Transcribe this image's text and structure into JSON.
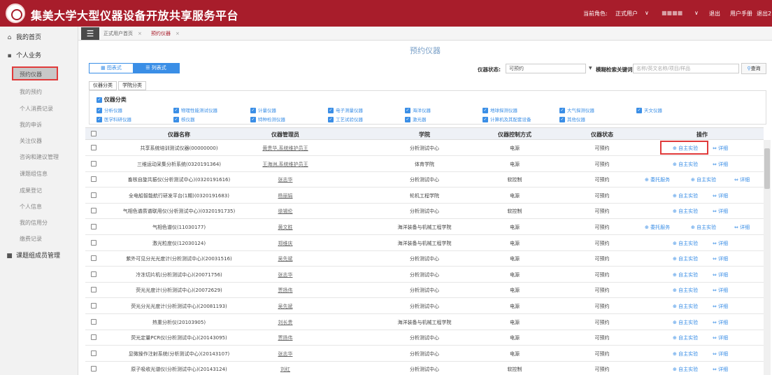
{
  "app": {
    "title": "集美大学大型仪器设备开放共享服务平台"
  },
  "topbar": {
    "role_label": "当前角色:",
    "role_value": "正式用户",
    "user_name": "■■■■",
    "logout": "退出",
    "manual": "用户手册",
    "last": "退出2"
  },
  "sidebar": {
    "items": [
      {
        "label": "我的首页",
        "icon": "home-icon",
        "type": "main"
      },
      {
        "label": "个人业务",
        "icon": "briefcase-icon",
        "type": "main"
      },
      {
        "label": "预约仪器",
        "type": "sub",
        "active": true
      },
      {
        "label": "我的预约",
        "type": "sub"
      },
      {
        "label": "个人消费记录",
        "type": "sub"
      },
      {
        "label": "我的申诉",
        "type": "sub"
      },
      {
        "label": "关注仪器",
        "type": "sub"
      },
      {
        "label": "咨询和建议管理",
        "type": "sub"
      },
      {
        "label": "课题组信息",
        "type": "sub"
      },
      {
        "label": "成果登记",
        "type": "sub"
      },
      {
        "label": "个人信息",
        "type": "sub"
      },
      {
        "label": "我的信用分",
        "type": "sub"
      },
      {
        "label": "缴费记录",
        "type": "sub"
      },
      {
        "label": "课题组成员管理",
        "icon": "book-icon",
        "type": "main"
      }
    ]
  },
  "tabs": [
    {
      "label": "正式用户首页",
      "close": "×"
    },
    {
      "label": "预约仪器",
      "close": "×"
    }
  ],
  "page": {
    "heading": "预约仪器"
  },
  "view": {
    "chart": "图表式",
    "list": "列表式"
  },
  "filter": {
    "status_label": "仪器状态:",
    "status_value": "可预约",
    "keyword_label": "模糊检索关键词:",
    "keyword_placeholder": "名称/英文名称/项目/样品",
    "search_btn": "查询"
  },
  "category_tabs": [
    "仪器分类",
    "学院分类"
  ],
  "categories": {
    "title": "仪器分类",
    "items": [
      "分析仪器",
      "物理性能测试仪器",
      "计量仪器",
      "电子测量仪器",
      "海洋仪器",
      "地球探测仪器",
      "大气探测仪器",
      "天文仪器",
      "医学科研仪器",
      "核仪器",
      "特种检测仪器",
      "工艺试验仪器",
      "激光器",
      "计算机及其配套设备",
      "其他仪器"
    ]
  },
  "table": {
    "headers": {
      "name": "仪器名称",
      "manager": "仪器管理员",
      "college": "学院",
      "control": "仪器控制方式",
      "status": "仪器状态",
      "ops": "操作"
    },
    "actions": {
      "entrust": "委托服务",
      "self": "自主实验",
      "detail": "详细"
    },
    "rows": [
      {
        "name": "共享系统培训测试仪器(00000000)",
        "manager": "黄贵华,系统维护员王",
        "college": "分析测试中心",
        "control": "电源",
        "status": "可预约",
        "entrust": false
      },
      {
        "name": "三维运动采集分析系统(0320191364)",
        "manager": "王海洲,系统维护员王",
        "college": "体育学院",
        "control": "电源",
        "status": "可预约",
        "entrust": false
      },
      {
        "name": "畜核自旋共振仪(分析测试中心)(0320191616)",
        "manager": "张志华",
        "college": "分析测试中心",
        "control": "软控制",
        "status": "可预约",
        "entrust": true
      },
      {
        "name": "全电船智能航行研发平台(1期)(0320191683)",
        "manager": "杨丽娟",
        "college": "轮机工程学院",
        "control": "电源",
        "status": "可预约",
        "entrust": false
      },
      {
        "name": "气相色谱质谱联用仪(分析测试中心)(0320191735)",
        "manager": "徐锡伦",
        "college": "分析测试中心",
        "control": "软控制",
        "status": "可预约",
        "entrust": false
      },
      {
        "name": "气相色谱仪(11030177)",
        "manager": "黄文胜",
        "college": "海洋装备与机械工程学院",
        "control": "电源",
        "status": "可预约",
        "entrust": true
      },
      {
        "name": "激光粒度仪(12030124)",
        "manager": "郑维庆",
        "college": "海洋装备与机械工程学院",
        "control": "电源",
        "status": "可预约",
        "entrust": false
      },
      {
        "name": "紫外可见分光光度计(分析测试中心)(20031516)",
        "manager": "吴先斌",
        "college": "分析测试中心",
        "control": "电源",
        "status": "可预约",
        "entrust": false
      },
      {
        "name": "冷冻切片机(分析测试中心)(20071756)",
        "manager": "张志华",
        "college": "分析测试中心",
        "control": "电源",
        "status": "可预约",
        "entrust": false
      },
      {
        "name": "荧光光度计(分析测试中心)(20072629)",
        "manager": "贾扬伟",
        "college": "分析测试中心",
        "control": "电源",
        "status": "可预约",
        "entrust": false
      },
      {
        "name": "荧光分光光度计(分析测试中心)(20081193)",
        "manager": "吴先斌",
        "college": "分析测试中心",
        "control": "电源",
        "status": "可预约",
        "entrust": false
      },
      {
        "name": "热重分析仪(20103905)",
        "manager": "刘长贵",
        "college": "海洋装备与机械工程学院",
        "control": "电源",
        "status": "可预约",
        "entrust": false
      },
      {
        "name": "荧光定量PCR仪(分析测试中心)(20143095)",
        "manager": "贾扬伟",
        "college": "分析测试中心",
        "control": "电源",
        "status": "可预约",
        "entrust": false
      },
      {
        "name": "显微操作注射系统(分析测试中心)(20143107)",
        "manager": "张志华",
        "college": "分析测试中心",
        "control": "电源",
        "status": "可预约",
        "entrust": false
      },
      {
        "name": "原子吸收光谱仪(分析测试中心)(20143124)",
        "manager": "刘红",
        "college": "分析测试中心",
        "control": "软控制",
        "status": "可预约",
        "entrust": false
      }
    ]
  }
}
